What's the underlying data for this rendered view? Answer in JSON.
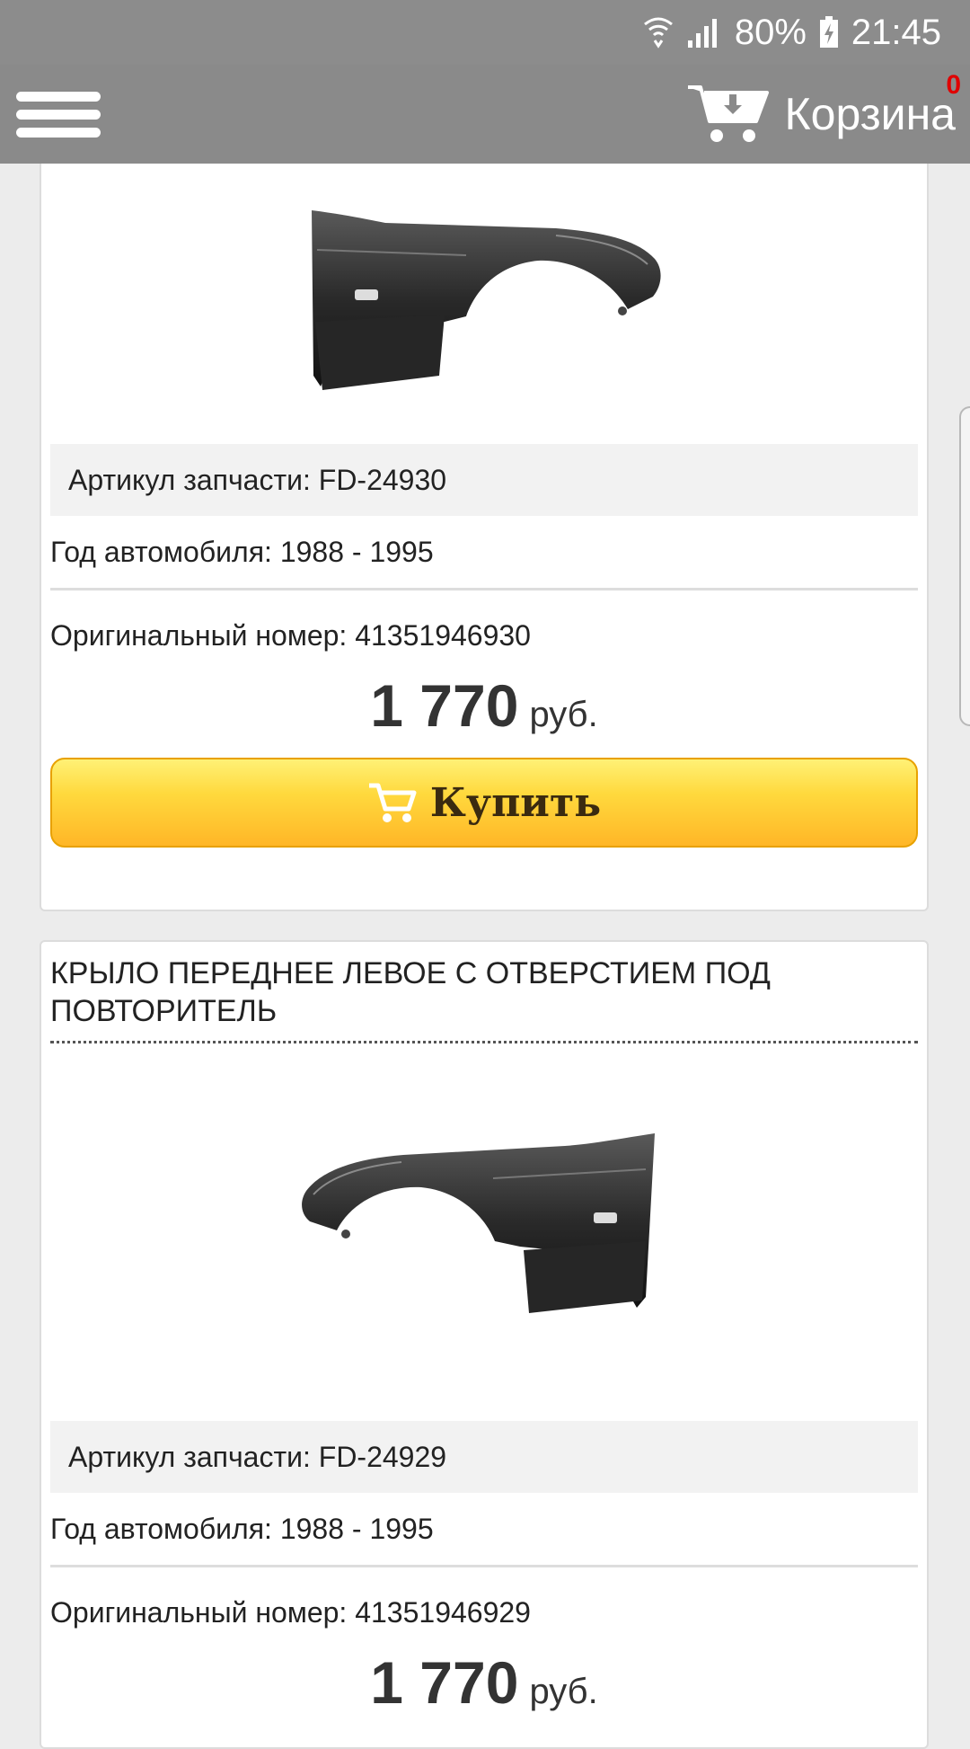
{
  "status_bar": {
    "battery": "80%",
    "time": "21:45"
  },
  "header": {
    "menu_icon": "hamburger-icon",
    "cart_icon": "cart-download-icon",
    "cart_label": "Корзина",
    "cart_count": "0"
  },
  "products": [
    {
      "article_label": "Артикул запчасти: FD-24930",
      "year_label": "Год автомобиля: 1988 - 1995",
      "oem_label": "Оригинальный номер: 41351946930",
      "price": "1 770",
      "currency": "руб.",
      "buy_label": "Купить",
      "image_icon": "right-front-fender-image"
    },
    {
      "title": "КРЫЛО ПЕРЕДНЕЕ ЛЕВОЕ С ОТВЕРСТИЕМ ПОД ПОВТОРИТЕЛЬ",
      "article_label": "Артикул запчасти: FD-24929",
      "year_label": "Год автомобиля: 1988 - 1995",
      "oem_label": "Оригинальный номер: 41351946929",
      "price": "1 770",
      "currency": "руб.",
      "image_icon": "left-front-fender-image"
    }
  ],
  "colors": {
    "header_bg": "#8a8a8a",
    "button_top": "#fff176",
    "button_bottom": "#ffb627",
    "cart_count": "#e00000"
  }
}
